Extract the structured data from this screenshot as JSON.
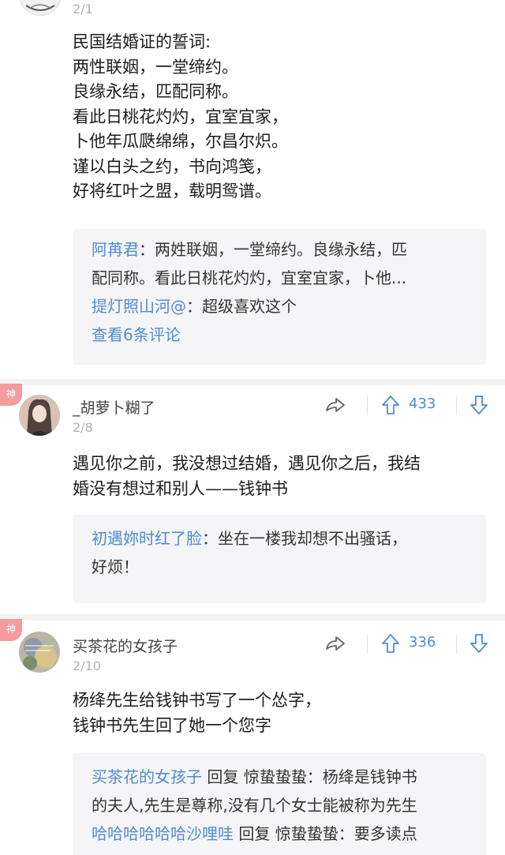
{
  "post1": {
    "floor": "2/1",
    "lines": [
      "民国结婚证的誓词:",
      "两性联姻，一堂缔约。",
      "良缘永结，匹配同称。",
      "看此日桃花灼灼，宜室宜家，",
      "卜他年瓜瓞绵绵，尔昌尔炽。",
      "谨以白头之约，书向鸿笺，",
      "好将红叶之盟，载明鸳谱。"
    ],
    "replies": {
      "r1_name": "阿苒君",
      "r1_text_a": "：两姓联姻，一堂缔约。良缘永结，匹",
      "r1_text_b": "配同称。看此日桃花灼灼，宜室宜家，卜他...",
      "r2_name": "提灯照山河@",
      "r2_text": "：超级喜欢这个",
      "view_all": "查看6条评论"
    }
  },
  "post2": {
    "badge": "神",
    "username": "_胡萝卜糊了",
    "floor": "2/8",
    "likes": "433",
    "line1": "遇见你之前，我没想过结婚，遇见你之后，我结",
    "line2": "婚没有想过和别人——钱钟书",
    "replies": {
      "r1_name": "初遇妳时红了脸",
      "r1_text_a": "：坐在一楼我却想不出骚话，",
      "r1_text_b": "好烦！"
    }
  },
  "post3": {
    "badge": "神",
    "username": "买茶花的女孩子",
    "floor": "2/10",
    "likes": "336",
    "line1": "杨绛先生给钱钟书写了一个怂字，",
    "line2": "钱钟书先生回了她一个您字",
    "replies": {
      "r1_name": "买茶花的女孩子",
      "r1_verb": " 回复 ",
      "r1_target": "惊蛰蛰蛰",
      "r1_text_a": "：杨绛是钱钟书",
      "r1_text_b": "的夫人,先生是尊称,没有几个女士能被称为先生",
      "r2_name": "哈哈哈哈哈哈沙哩哇",
      "r2_verb": " 回复 ",
      "r2_target": "惊蛰蛰蛰",
      "r2_text": "：要多读点"
    }
  },
  "icons": {
    "share": "share-arrow-icon",
    "upvote": "arrow-up-icon",
    "downvote": "arrow-down-icon",
    "badge": "god-comment-badge"
  },
  "colors": {
    "accent": "#4f8ccf",
    "badge": "#f59b9b",
    "reply_bg": "#f5f5f7"
  }
}
